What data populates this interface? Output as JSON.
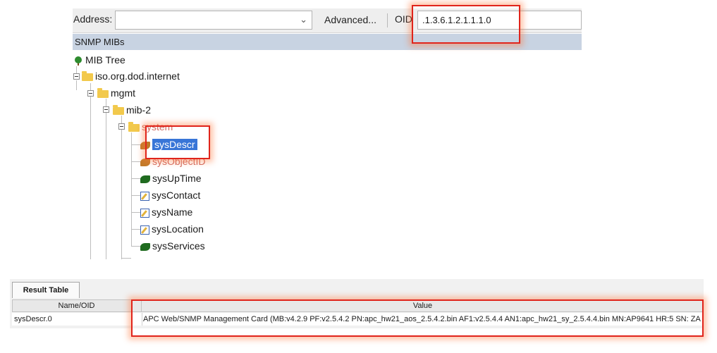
{
  "toolbar": {
    "address_label": "Address:",
    "address_value": "",
    "advanced_label": "Advanced...",
    "oid_label": "OID",
    "oid_value": ".1.3.6.1.2.1.1.1.0"
  },
  "mib_panel": {
    "header": "SNMP MIBs",
    "tree": {
      "root": "MIB Tree",
      "internet": "iso.org.dod.internet",
      "mgmt": "mgmt",
      "mib2": "mib-2",
      "system": "system",
      "items": [
        "sysDescr",
        "sysObjectID",
        "sysUpTime",
        "sysContact",
        "sysName",
        "sysLocation",
        "sysServices"
      ]
    }
  },
  "result": {
    "tab_label": "Result Table",
    "columns": [
      "Name/OID",
      "Value"
    ],
    "rows": [
      {
        "name": "sysDescr.0",
        "value": "APC Web/SNMP Management Card (MB:v4.2.9 PF:v2.5.4.2 PN:apc_hw21_aos_2.5.4.2.bin AF1:v2.5.4.4 AN1:apc_hw21_sy_2.5.4.4.bin MN:AP9641 HR:5 SN: ZA"
      }
    ]
  },
  "colors": {
    "selection": "#3875d7",
    "highlight": "#e0241b",
    "header_band": "#c8d3e2"
  },
  "icons": [
    "tree-icon",
    "folder-icon",
    "leaf-icon",
    "edit-icon",
    "chevron-down-icon"
  ]
}
